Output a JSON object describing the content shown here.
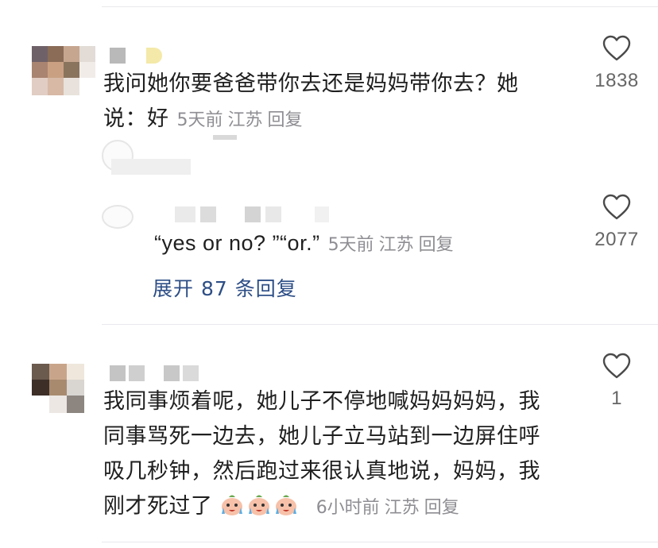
{
  "comments": [
    {
      "text_line1": "我问她你要爸爸带你去还是妈妈带你去？她",
      "text_line2": "说：好",
      "time": "5天前",
      "location": "江苏",
      "reply_label": "回复",
      "likes": "1838"
    },
    {
      "text": "“yes or no? ”“or.”",
      "time": "5天前",
      "location": "江苏",
      "reply_label": "回复",
      "likes": "2077"
    },
    {
      "text_line1": "我同事烦着呢，她儿子不停地喊妈妈妈妈，我",
      "text_line2": "同事骂死一边去，她儿子立马站到一边屏住呼",
      "text_line3": "吸几秒钟，然后跑过来很认真地说，妈妈，我",
      "text_line4": "刚才死过了",
      "emojis": [
        "crying-face-emoji",
        "crying-face-emoji",
        "crying-face-emoji"
      ],
      "time": "6小时前",
      "location": "江苏",
      "reply_label": "回复",
      "likes": "1"
    }
  ],
  "expand_replies": "展开 87 条回复",
  "icons": {
    "like": "heart-outline-icon"
  },
  "colors": {
    "meta": "#8e8e93",
    "link": "#2d4e86",
    "text": "#1f1f1f"
  }
}
